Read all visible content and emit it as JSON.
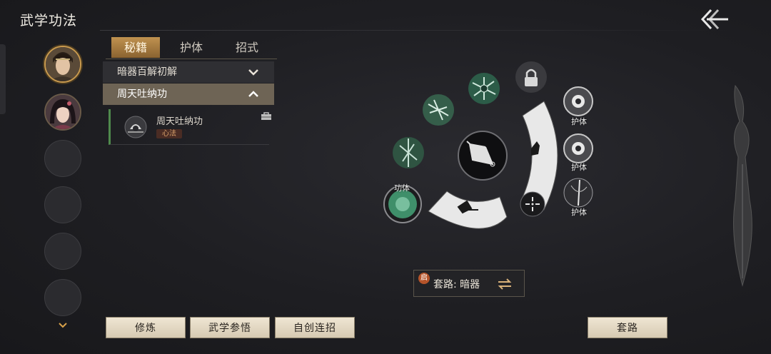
{
  "header": {
    "title": "武学功法"
  },
  "avatars": [
    {
      "name": "avatar-male-hero"
    },
    {
      "name": "avatar-female-hero"
    }
  ],
  "tabs": [
    {
      "label": "秘籍",
      "active": true
    },
    {
      "label": "护体",
      "active": false
    },
    {
      "label": "招式",
      "active": false
    }
  ],
  "list": {
    "row1": {
      "label": "暗器百解初解",
      "expanded": false
    },
    "row2": {
      "label": "周天吐纳功",
      "expanded": true
    },
    "sub": {
      "name": "周天吐纳功",
      "badge": "心法"
    }
  },
  "skills": {
    "gongti_label": "功体",
    "huti_label_1": "护体",
    "huti_label_2": "护体",
    "huti_label_3": "护体"
  },
  "combo": {
    "badge": "启",
    "text": "套路: 暗器"
  },
  "buttons": {
    "practice": "修炼",
    "comprehend": "武学参悟",
    "custom_combo": "自创连招",
    "routine": "套路"
  },
  "colors": {
    "accent": "#c09250",
    "jade": "#3f8f6a",
    "badge": "#b5542a"
  }
}
